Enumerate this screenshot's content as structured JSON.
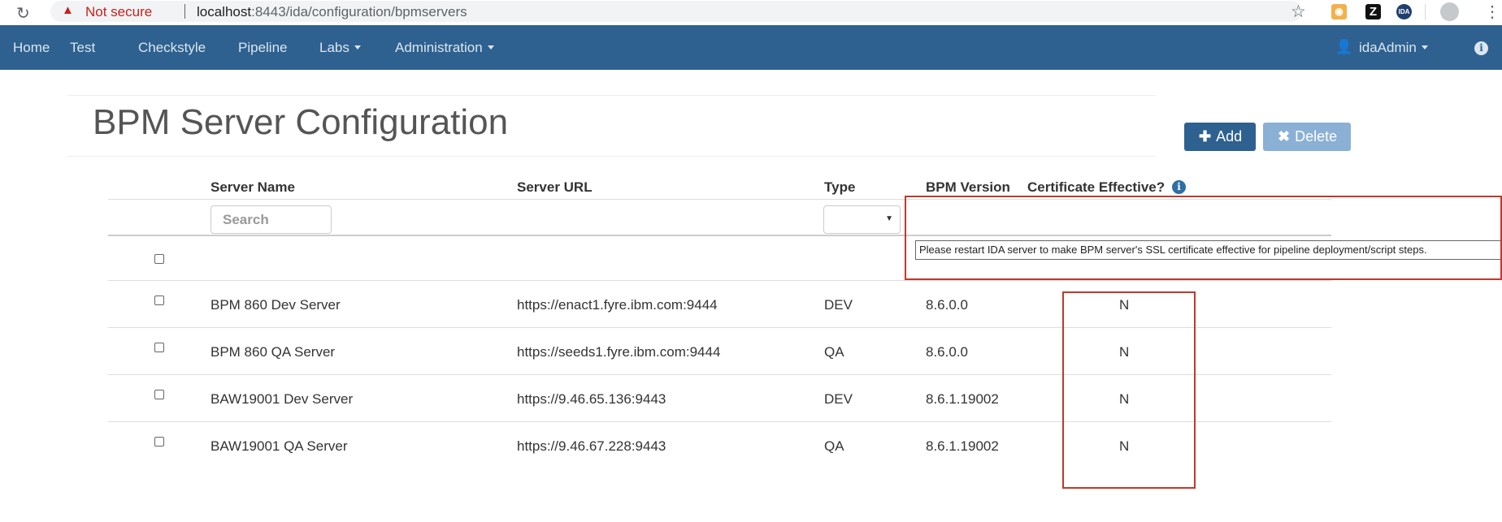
{
  "browser": {
    "not_secure": "Not secure",
    "url_host": "localhost",
    "url_rest": ":8443/ida/configuration/bpmservers",
    "ext_z": "Z",
    "ext_ida": "IDA"
  },
  "nav": {
    "items": [
      "Home",
      "Test",
      "Checkstyle",
      "Pipeline",
      "Labs",
      "Administration"
    ],
    "user": "idaAdmin"
  },
  "page": {
    "title": "BPM Server Configuration",
    "add_label": "Add",
    "delete_label": "Delete"
  },
  "table": {
    "headers": {
      "server_name": "Server Name",
      "server_url": "Server URL",
      "type": "Type",
      "bpm_version": "BPM Version",
      "certificate": "Certificate Effective?"
    },
    "search_placeholder": "Search",
    "tooltip": "Please restart IDA server to make BPM server's SSL certificate effective for pipeline deployment/script steps.",
    "rows": [
      {
        "name": "BPM 860 Dev Server",
        "url": "https://enact1.fyre.ibm.com:9444",
        "type": "DEV",
        "version": "8.6.0.0",
        "cert": "N"
      },
      {
        "name": "BPM 860 QA Server",
        "url": "https://seeds1.fyre.ibm.com:9444",
        "type": "QA",
        "version": "8.6.0.0",
        "cert": "N"
      },
      {
        "name": "BAW19001 Dev Server",
        "url": "https://9.46.65.136:9443",
        "type": "DEV",
        "version": "8.6.1.19002",
        "cert": "N"
      },
      {
        "name": "BAW19001 QA Server",
        "url": "https://9.46.67.228:9443",
        "type": "QA",
        "version": "8.6.1.19002",
        "cert": "N"
      }
    ]
  }
}
